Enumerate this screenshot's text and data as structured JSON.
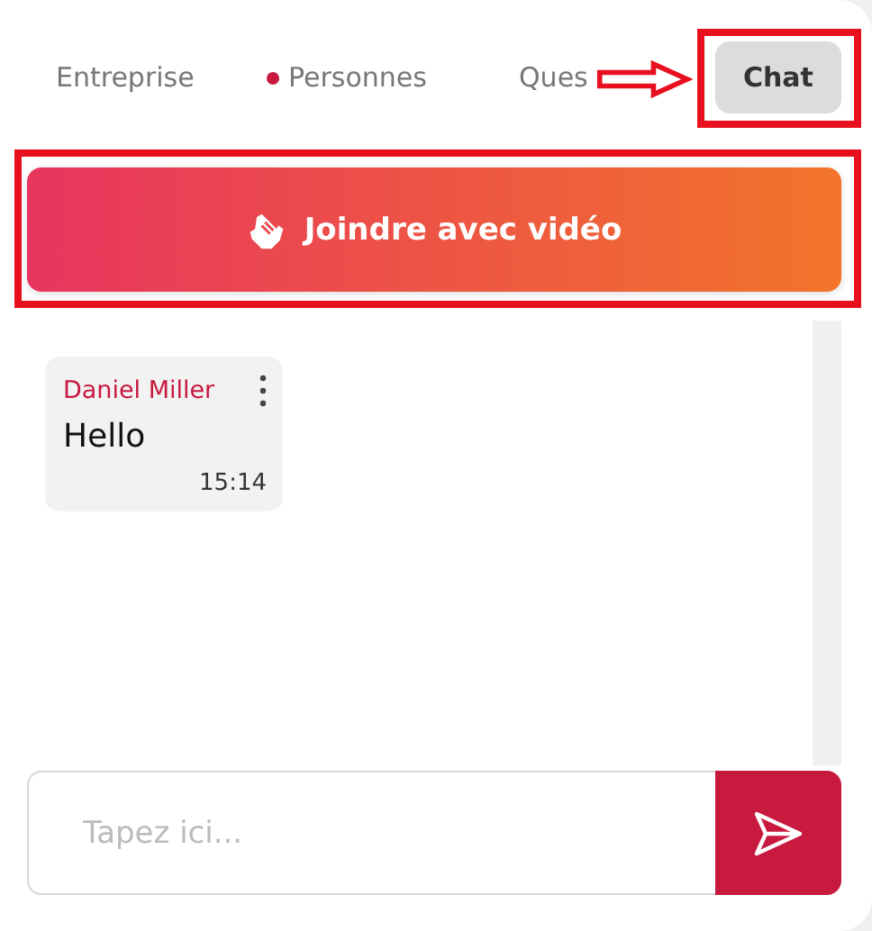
{
  "tabs": [
    {
      "label": "Entreprise",
      "selected": false,
      "unread": false
    },
    {
      "label": "Personnes",
      "selected": false,
      "unread": true
    },
    {
      "label": "Ques",
      "selected": false,
      "unread": false
    },
    {
      "label": "Chat",
      "selected": true,
      "unread": false
    }
  ],
  "join_button": {
    "label": "Joindre avec vidéo"
  },
  "messages": [
    {
      "author": "Daniel Miller",
      "text": "Hello",
      "time": "15:14"
    }
  ],
  "composer": {
    "placeholder": "Tapez ici..."
  }
}
